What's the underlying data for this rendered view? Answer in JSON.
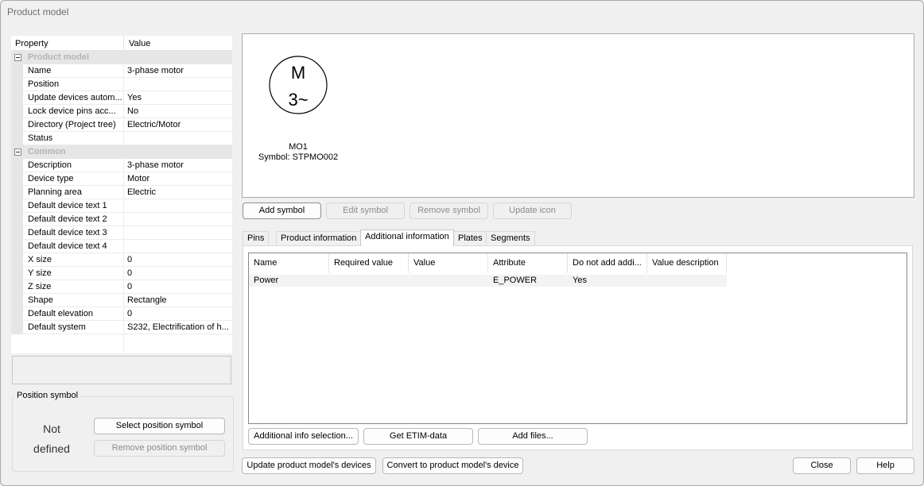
{
  "window": {
    "title": "Product model"
  },
  "grid": {
    "header": {
      "property": "Property",
      "value": "Value"
    },
    "categories": [
      {
        "label": "Product model",
        "props": [
          {
            "name": "Name",
            "value": "3-phase motor"
          },
          {
            "name": "Position",
            "value": ""
          },
          {
            "name": "Update devices autom...",
            "value": "Yes"
          },
          {
            "name": "Lock device pins acc...",
            "value": "No"
          },
          {
            "name": "Directory (Project tree)",
            "value": "Electric/Motor"
          },
          {
            "name": "Status",
            "value": ""
          }
        ]
      },
      {
        "label": "Common",
        "props": [
          {
            "name": "Description",
            "value": "3-phase motor"
          },
          {
            "name": "Device type",
            "value": "Motor"
          },
          {
            "name": "Planning area",
            "value": "Electric"
          },
          {
            "name": "Default device text 1",
            "value": ""
          },
          {
            "name": "Default device text 2",
            "value": ""
          },
          {
            "name": "Default device text 3",
            "value": ""
          },
          {
            "name": "Default device text 4",
            "value": ""
          },
          {
            "name": "X size",
            "value": "0"
          },
          {
            "name": "Y size",
            "value": "0"
          },
          {
            "name": "Z size",
            "value": "0"
          },
          {
            "name": "Shape",
            "value": "Rectangle"
          },
          {
            "name": "Default elevation",
            "value": "0"
          },
          {
            "name": "Default system",
            "value": "S232, Electrification of h..."
          }
        ]
      }
    ]
  },
  "position_symbol": {
    "legend": "Position symbol",
    "not_defined_1": "Not",
    "not_defined_2": "defined",
    "select_button": "Select position symbol",
    "remove_button": "Remove position symbol"
  },
  "preview": {
    "symbol_m": "M",
    "symbol_3": "3~",
    "device_label": "MO1",
    "symbol_label": "Symbol: STPMO002"
  },
  "symbol_buttons": {
    "add": "Add symbol",
    "edit": "Edit symbol",
    "remove": "Remove symbol",
    "update_icon": "Update icon"
  },
  "tabs": [
    "Pins",
    "Product information",
    "Additional information",
    "Plates",
    "Segments"
  ],
  "active_tab": "Additional information",
  "info_list": {
    "columns": [
      "Name",
      "Required value",
      "Value",
      "Attribute",
      "Do not add addi...",
      "Value description"
    ],
    "rows": [
      [
        "Power",
        "",
        "",
        "E_POWER",
        "Yes",
        ""
      ]
    ]
  },
  "panel_buttons": {
    "selection": "Additional info selection...",
    "etim": "Get ETIM-data",
    "files": "Add files..."
  },
  "footer": {
    "update_devices": "Update product model's devices",
    "convert": "Convert to product model's device",
    "close": "Close",
    "help": "Help"
  },
  "colors": {
    "window_bg": "#f0f0f0",
    "category_bg": "#e6e6e6",
    "disabled_text": "#8c8c8c"
  }
}
